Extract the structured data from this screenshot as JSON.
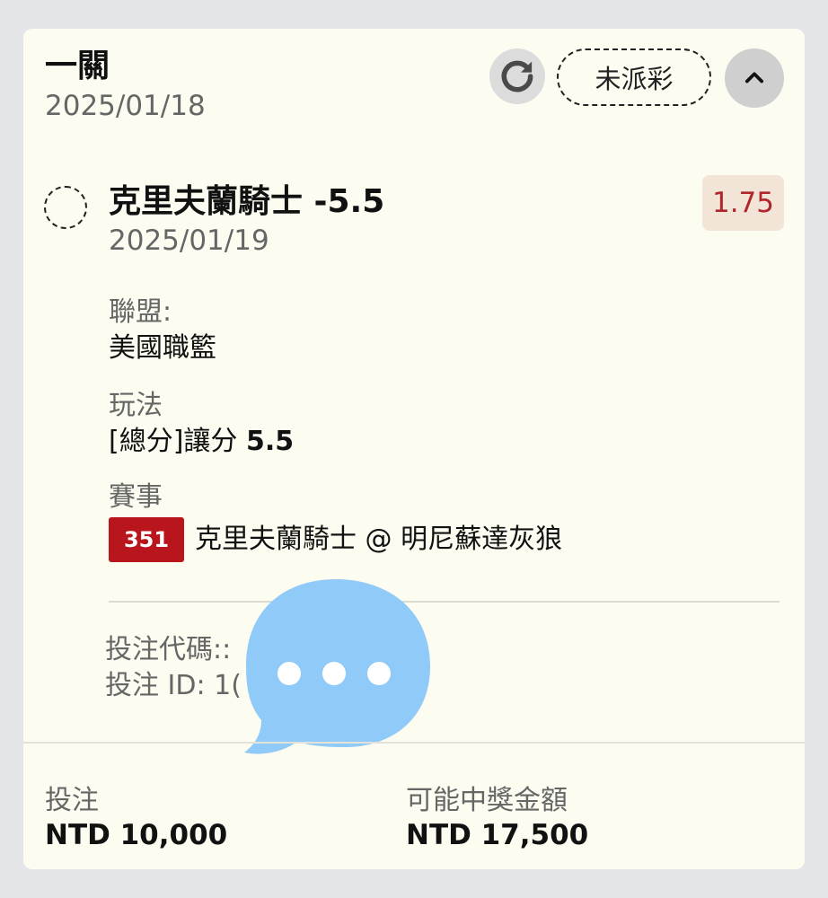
{
  "bet": {
    "title": "一關",
    "date": "2025/01/18",
    "status": "未派彩"
  },
  "selection": {
    "name": "克里夫蘭騎士 -5.5",
    "date": "2025/01/19",
    "odds": "1.75",
    "league_label": "聯盟:",
    "league_value": "美國職籃",
    "market_label": "玩法",
    "market_prefix": "[總分]讓分 ",
    "market_line": "5.5",
    "event_label": "賽事",
    "event_code": "351",
    "event_name": "克里夫蘭騎士 @ 明尼蘇達灰狼"
  },
  "meta": {
    "code_label": "投注代碼::",
    "id_label": "投注 ID: 1("
  },
  "footer": {
    "stake_label": "投注",
    "stake_value": "NTD 10,000",
    "payout_label": "可能中獎金額",
    "payout_value": "NTD 17,500"
  },
  "icons": {
    "refresh": "refresh-icon",
    "collapse": "chevron-up-icon",
    "overlay": "chat-bubble-icon"
  },
  "colors": {
    "card_bg": "#fdfcf1",
    "odds_text": "#b0262a",
    "odds_bg": "#f3e4d8",
    "event_code_bg": "#b8161c",
    "bubble": "#90caf9"
  }
}
